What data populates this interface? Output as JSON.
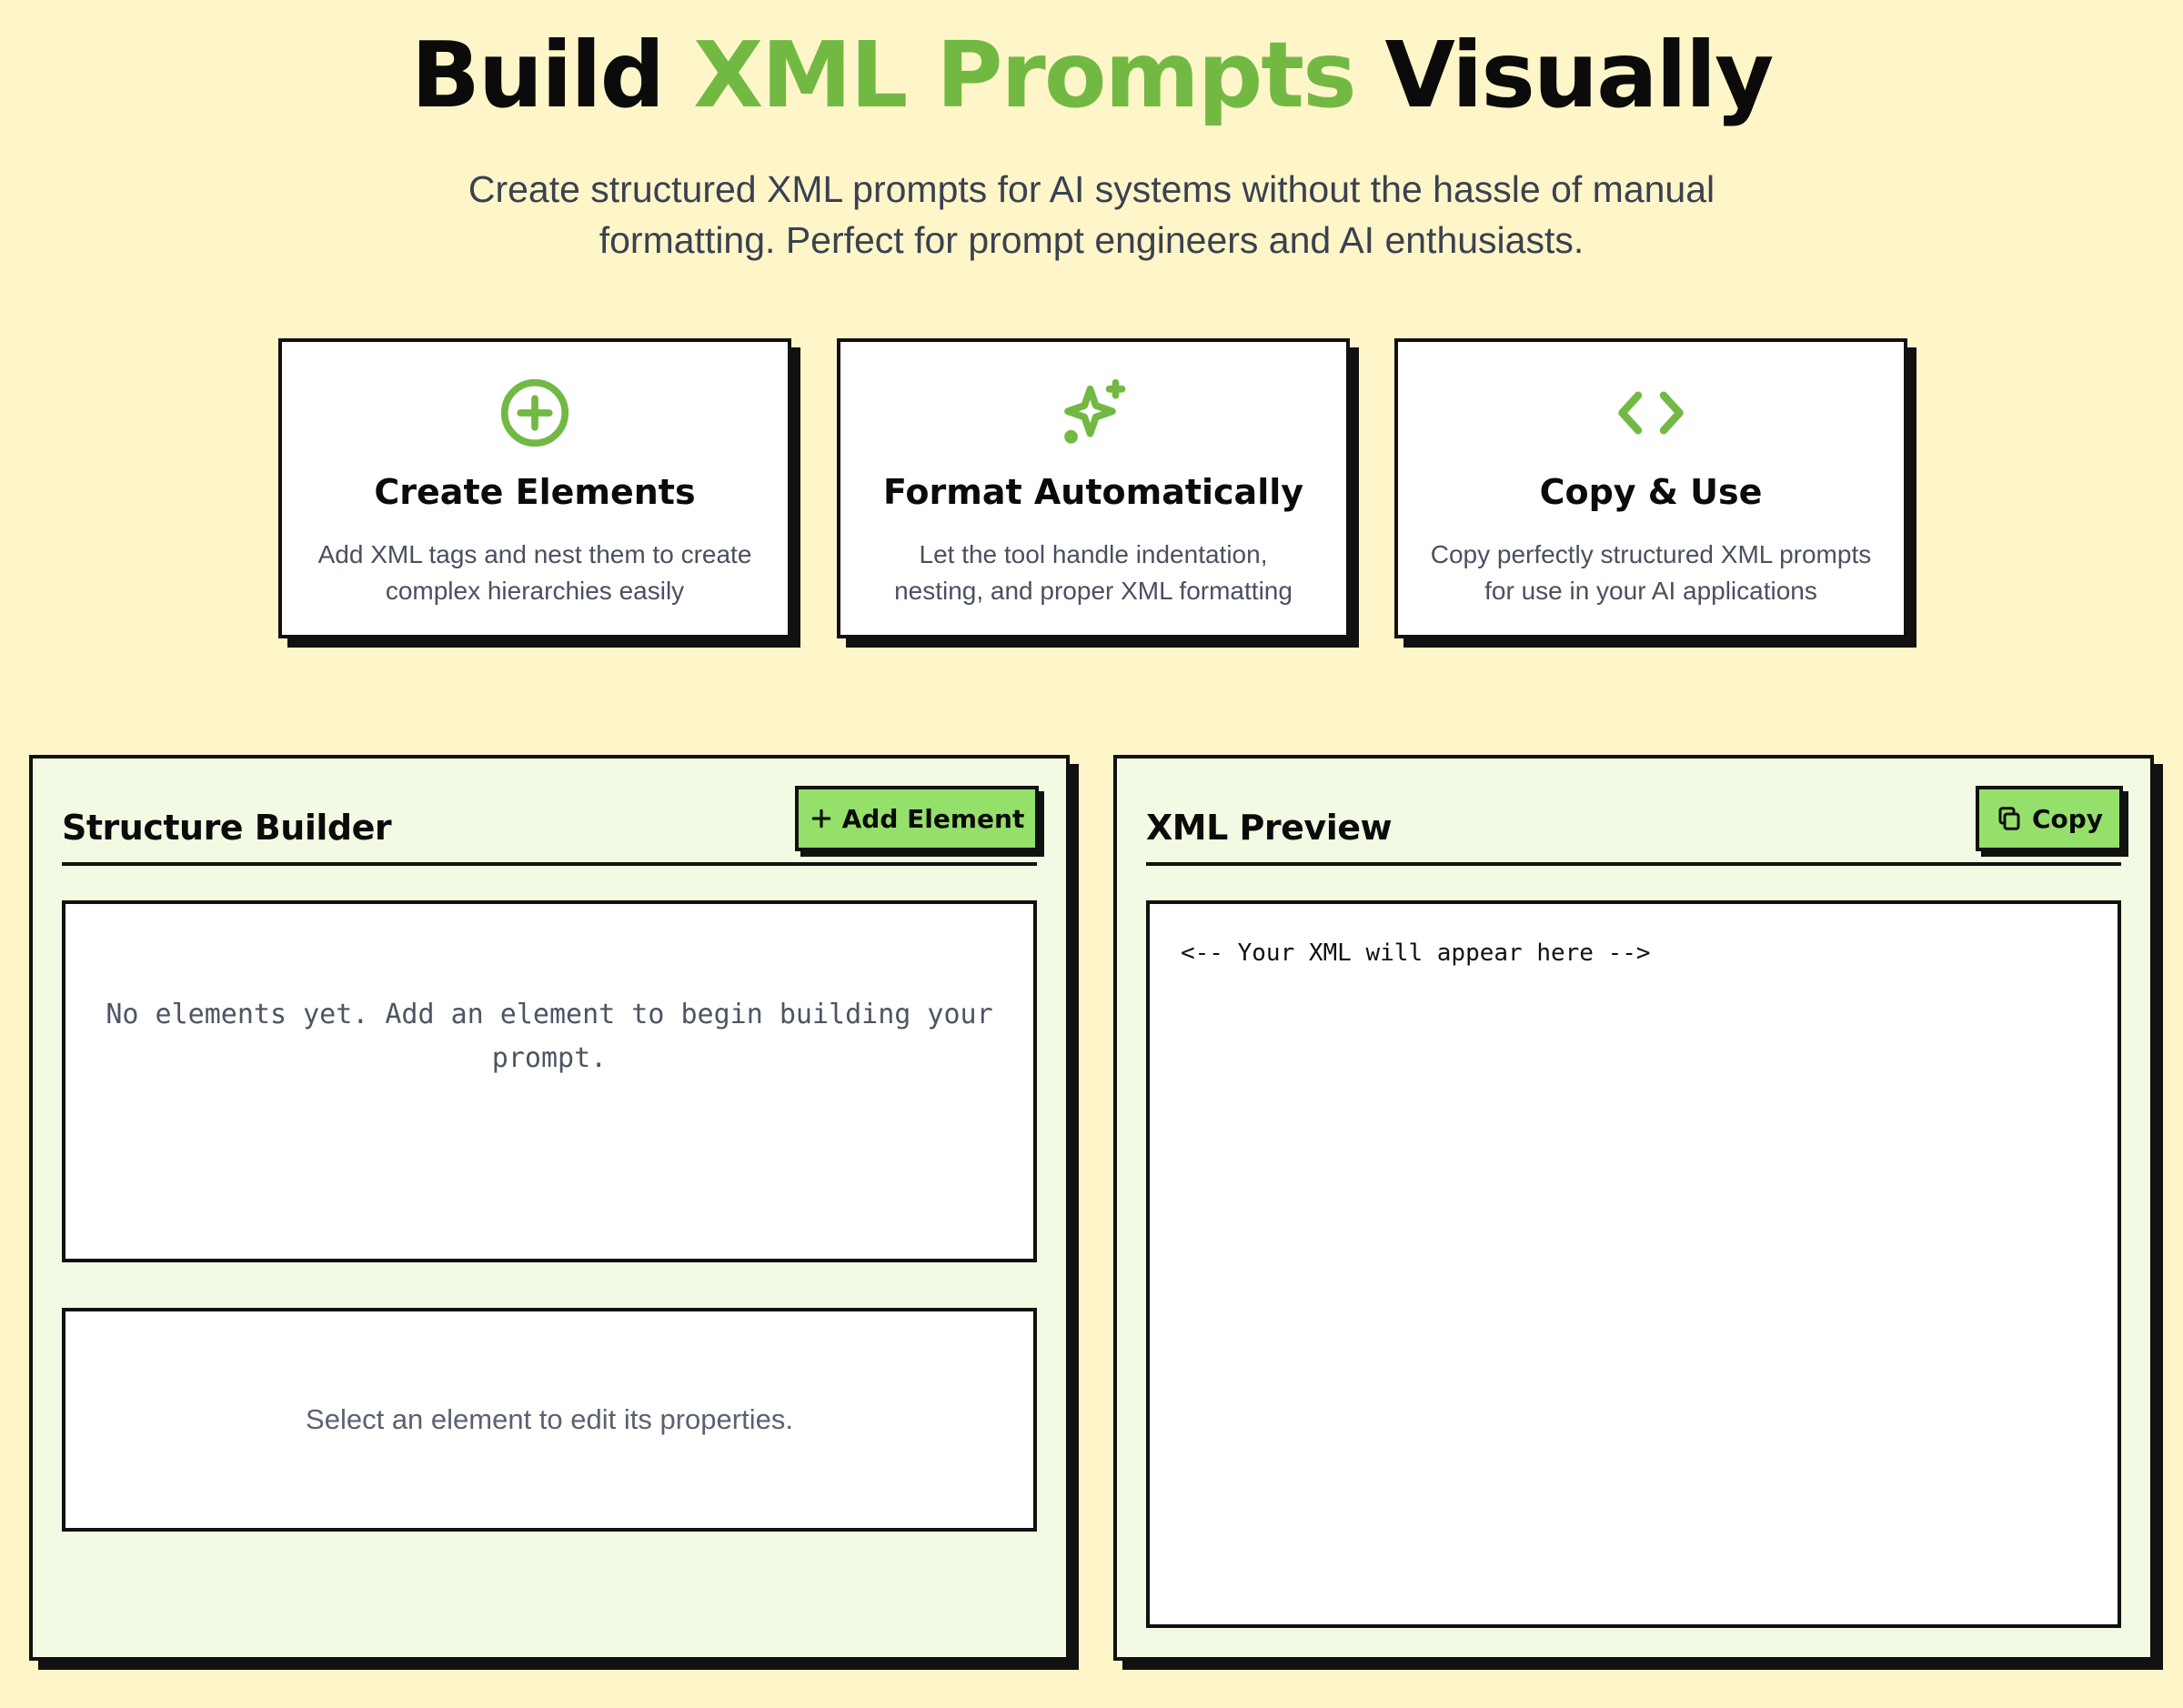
{
  "hero": {
    "title_part1": "Build ",
    "title_accent": "XML Prompts",
    "title_part2": " Visually",
    "subtitle_line1": "Create structured XML prompts for AI systems without the hassle of manual",
    "subtitle_line2": "formatting. Perfect for prompt engineers and AI enthusiasts."
  },
  "features": [
    {
      "icon": "plus-circle-icon",
      "title": "Create Elements",
      "desc_line1": "Add XML tags and nest them to create",
      "desc_line2": "complex hierarchies easily"
    },
    {
      "icon": "sparkles-icon",
      "title": "Format Automatically",
      "desc_line1": "Let the tool handle indentation,",
      "desc_line2": "nesting, and proper XML formatting"
    },
    {
      "icon": "code-icon",
      "title": "Copy & Use",
      "desc_line1": "Copy perfectly structured XML prompts",
      "desc_line2": "for use in your AI applications"
    }
  ],
  "builder": {
    "title": "Structure Builder",
    "add_button_icon": "plus-icon",
    "add_button_label": "Add Element",
    "empty_message": "No elements yet. Add an element to begin building your prompt.",
    "properties_message": "Select an element to edit its properties."
  },
  "preview": {
    "title": "XML Preview",
    "copy_button_icon": "copy-icon",
    "copy_button_label": "Copy",
    "placeholder": "<-- Your XML will appear here -->"
  },
  "colors": {
    "background": "#fef6c9",
    "accent": "#72b944",
    "button": "#95e06b",
    "panel": "#f2fae3"
  }
}
